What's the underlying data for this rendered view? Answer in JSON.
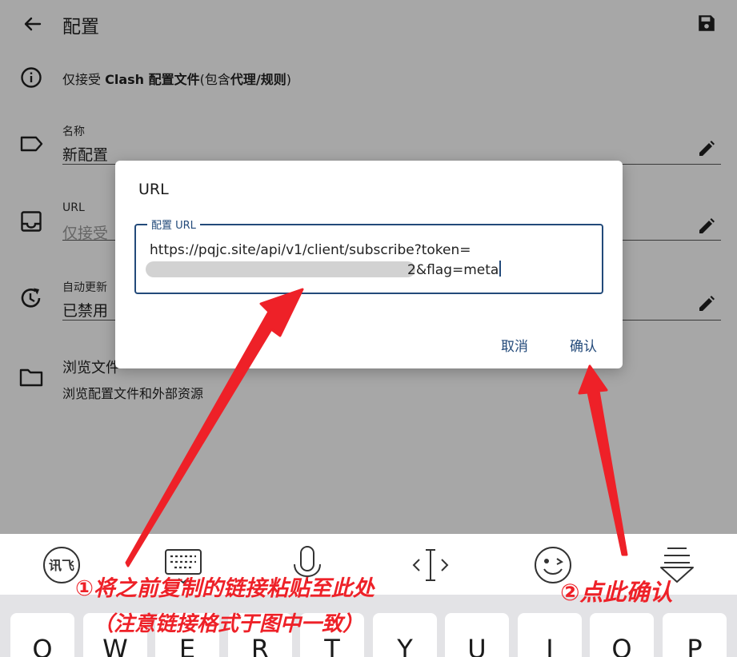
{
  "app": {
    "title": "配置",
    "info_pre": "仅接受 ",
    "info_bold1": "Clash 配置文件",
    "info_mid": "(包含",
    "info_bold2": "代理/规则",
    "info_post": ")",
    "fields": [
      {
        "label": "名称",
        "value": "新配置"
      },
      {
        "label": "URL",
        "value": "仅接受"
      },
      {
        "label": "自动更新",
        "value": "已禁用"
      }
    ],
    "browse": {
      "title": "浏览文件",
      "subtitle": "浏览配置文件和外部资源"
    }
  },
  "dialog": {
    "title": "URL",
    "field_label": "配置 URL",
    "url_line1": "https://pqjc.site/api/v1/client/subscribe?token=",
    "url_line2": "2&flag=meta",
    "cancel": "取消",
    "confirm": "确认"
  },
  "keyboard": {
    "keys": [
      "Q",
      "W",
      "E",
      "R",
      "T",
      "Y",
      "U",
      "I",
      "O",
      "P"
    ],
    "tools": [
      "ifly-logo-icon",
      "keyboard-icon",
      "microphone-icon",
      "cursor-move-icon",
      "emoji-icon",
      "hide-keyboard-icon"
    ]
  },
  "annotations": {
    "step1_line1": "①将之前复制的链接粘贴至此处",
    "step1_line2": "（注意链接格式于图中一致）",
    "step2": "②点此确认",
    "color": "#ee2128"
  }
}
